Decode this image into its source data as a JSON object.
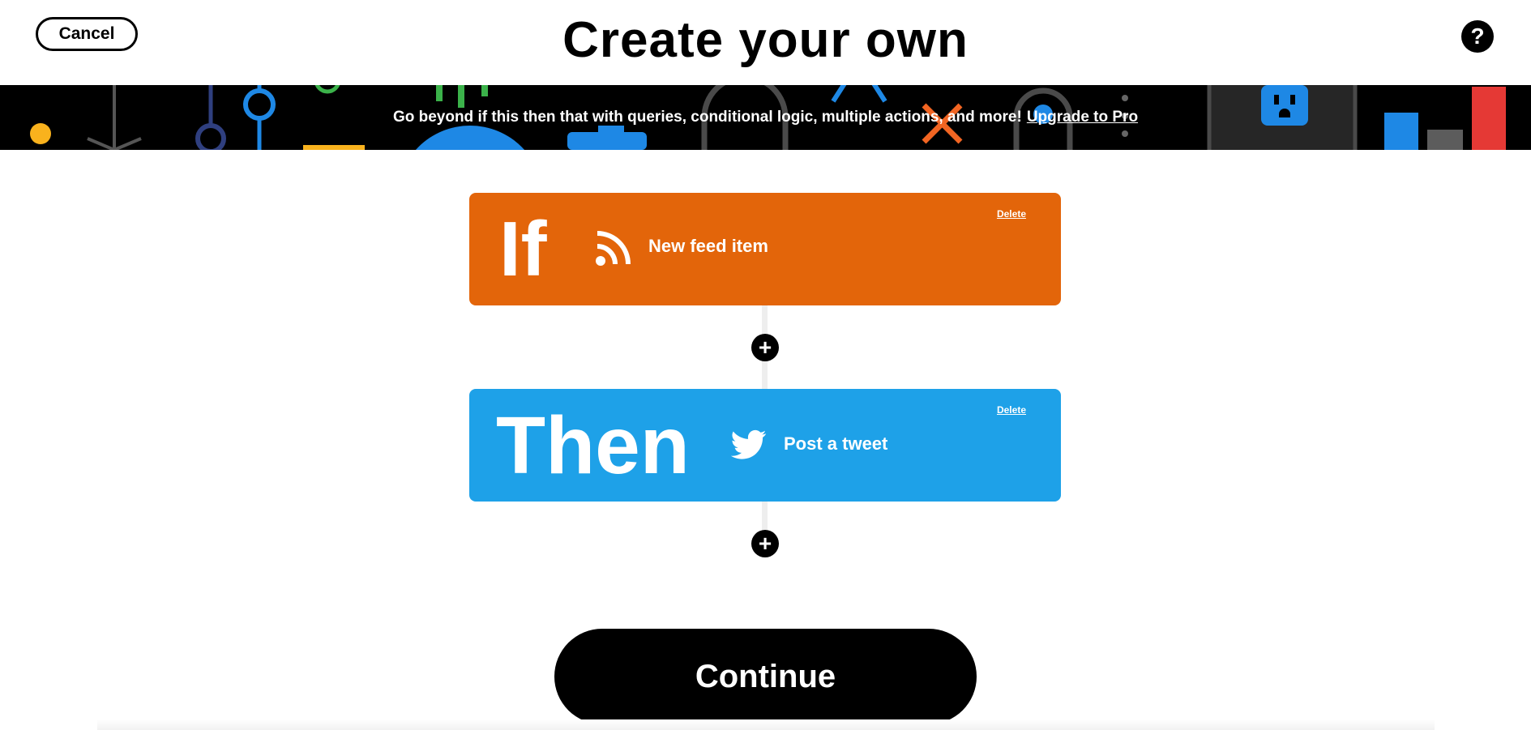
{
  "header": {
    "cancel_label": "Cancel",
    "title": "Create your own",
    "help_icon": "question-mark-icon",
    "help_glyph": "?"
  },
  "banner": {
    "message": "Go beyond if this then that with queries, conditional logic, multiple actions, and more!",
    "link_label": "Upgrade to Pro",
    "background": "#000000"
  },
  "trigger": {
    "keyword": "If",
    "service_icon": "rss-feed-icon",
    "label": "New feed item",
    "delete_label": "Delete",
    "color": "#e3650a"
  },
  "action": {
    "keyword": "Then",
    "service_icon": "twitter-bird-icon",
    "label": "Post a tweet",
    "delete_label": "Delete",
    "color": "#1ea1e8"
  },
  "add_step": {
    "icon": "plus-icon",
    "glyph": "+"
  },
  "footer": {
    "continue_label": "Continue"
  }
}
